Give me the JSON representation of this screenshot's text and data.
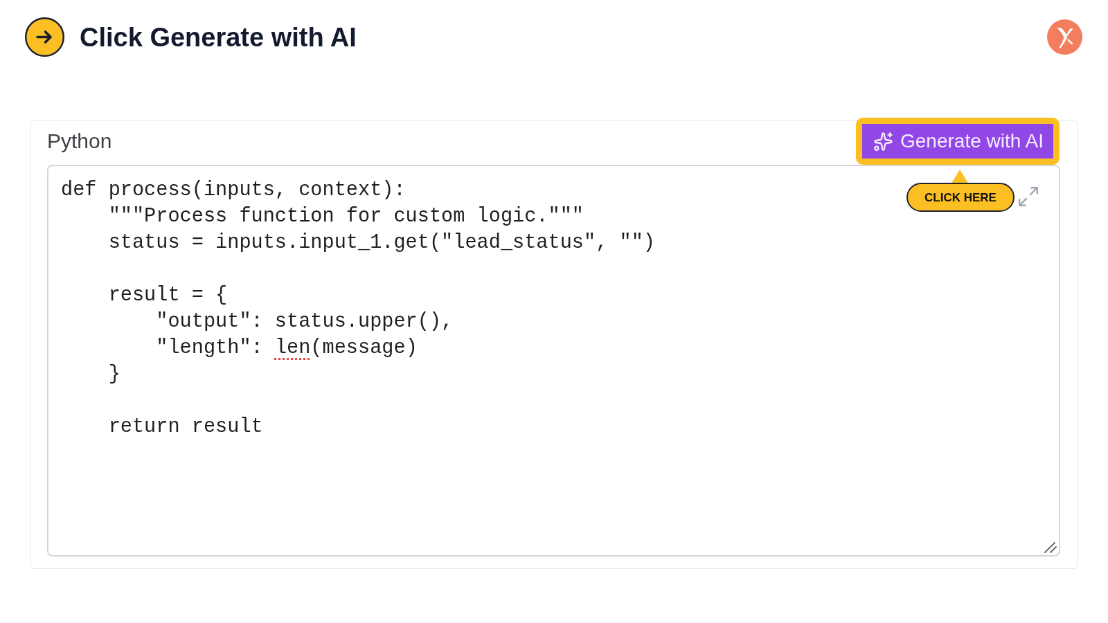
{
  "step": {
    "title": "Click Generate with AI"
  },
  "editor": {
    "language": "Python",
    "generate_button": {
      "label": "Generate with AI",
      "highlighted": true
    },
    "callout": {
      "label": "CLICK HERE"
    },
    "code": {
      "lines": [
        {
          "kind": "code",
          "parts": [
            {
              "text": "def process(inputs, context):",
              "spell_error": false
            }
          ]
        },
        {
          "kind": "code",
          "parts": [
            {
              "text": "    \"\"\"Process function for custom logic.\"\"\"",
              "spell_error": false
            }
          ]
        },
        {
          "kind": "code",
          "parts": [
            {
              "text": "    status = inputs.input_1.get(\"lead_status\", \"\")",
              "spell_error": false
            }
          ]
        },
        {
          "kind": "blank"
        },
        {
          "kind": "code",
          "parts": [
            {
              "text": "    result = {",
              "spell_error": false
            }
          ]
        },
        {
          "kind": "code",
          "parts": [
            {
              "text": "        \"output\": status.upper(),",
              "spell_error": false
            }
          ]
        },
        {
          "kind": "code",
          "parts": [
            {
              "text": "        \"length\": ",
              "spell_error": false
            },
            {
              "text": "len",
              "spell_error": true
            },
            {
              "text": "(message)",
              "spell_error": false
            }
          ]
        },
        {
          "kind": "code",
          "parts": [
            {
              "text": "    }",
              "spell_error": false
            }
          ]
        },
        {
          "kind": "blank"
        },
        {
          "kind": "code",
          "parts": [
            {
              "text": "    return result",
              "spell_error": false
            }
          ]
        }
      ]
    }
  }
}
